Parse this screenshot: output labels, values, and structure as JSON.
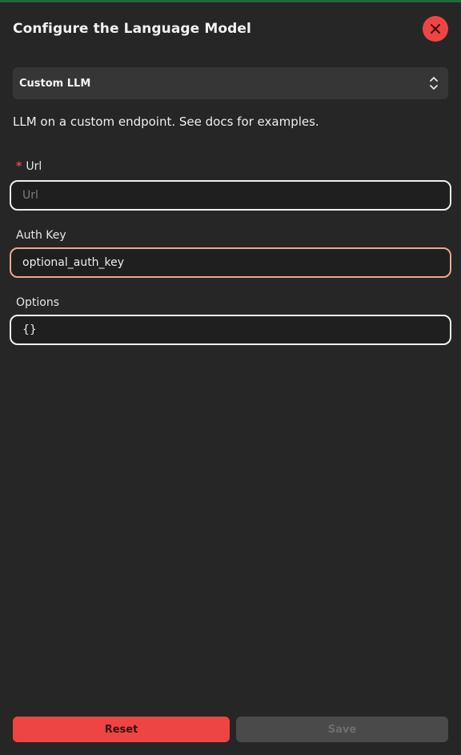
{
  "dialog": {
    "title": "Configure the Language Model",
    "close_icon": "close-icon"
  },
  "model_select": {
    "selected": "Custom LLM",
    "icon": "chevron-up-down-icon"
  },
  "description": "LLM on a custom endpoint. See docs for examples.",
  "fields": {
    "url": {
      "required_marker": "*",
      "label": "Url",
      "placeholder": "Url",
      "value": ""
    },
    "auth_key": {
      "label": "Auth Key",
      "placeholder": "",
      "value": "optional_auth_key"
    },
    "options": {
      "label": "Options",
      "value": "{}"
    }
  },
  "buttons": {
    "reset": "Reset",
    "save": "Save"
  },
  "colors": {
    "background": "#262626",
    "accent_red": "#ef4444",
    "focus_border": "#e9a98a",
    "disabled_button": "#4a4a4a"
  }
}
